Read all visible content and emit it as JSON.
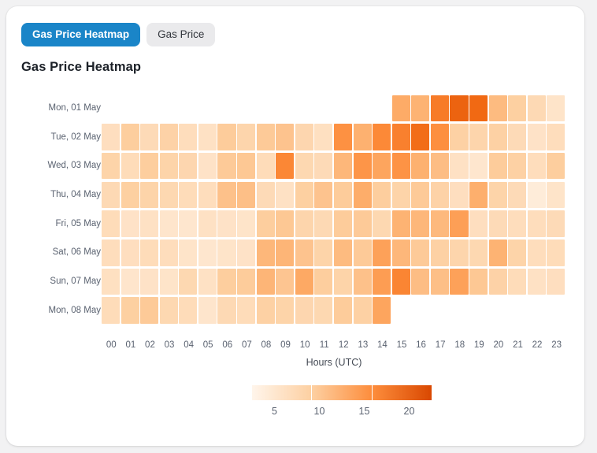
{
  "tabs": [
    {
      "label": "Gas Price Heatmap",
      "active": true
    },
    {
      "label": "Gas Price",
      "active": false
    }
  ],
  "chart_title": "Gas Price Heatmap",
  "colors": {
    "accent": "#1a85c8",
    "tab_inactive_bg": "#eaeaec",
    "card_bg": "#ffffff",
    "page_bg": "#f2f2f3",
    "heat_low": "#fff5eb",
    "heat_high": "#f2711c",
    "axis_text": "#5a6270"
  },
  "chart_data": {
    "type": "heatmap",
    "title": "Gas Price Heatmap",
    "xlabel": "Hours (UTC)",
    "ylabel": "",
    "grid": false,
    "legend_position": "bottom",
    "colorbar": {
      "ticks": [
        "5",
        "10",
        "15",
        "20"
      ],
      "tick_values": [
        5,
        10,
        15,
        20
      ],
      "vmin": 2.5,
      "vmax": 22.5,
      "colormap": "Oranges",
      "segments": 3
    },
    "x": [
      "00",
      "01",
      "02",
      "03",
      "04",
      "05",
      "06",
      "07",
      "08",
      "09",
      "10",
      "11",
      "12",
      "13",
      "14",
      "15",
      "16",
      "17",
      "18",
      "19",
      "20",
      "21",
      "22",
      "23"
    ],
    "y": [
      "Mon, 01 May",
      "Tue, 02 May",
      "Wed, 03 May",
      "Thu, 04 May",
      "Fri, 05 May",
      "Sat, 06 May",
      "Sun, 07 May",
      "Mon, 08 May"
    ],
    "values": [
      [
        null,
        null,
        null,
        null,
        null,
        null,
        null,
        null,
        null,
        null,
        null,
        null,
        null,
        null,
        null,
        12.8,
        12.0,
        17.5,
        19.8,
        19.2,
        11.2,
        9.2,
        7.8,
        6.2
      ],
      [
        7.0,
        9.4,
        7.6,
        8.8,
        7.2,
        6.6,
        9.6,
        8.4,
        9.8,
        10.4,
        8.2,
        6.8,
        15.4,
        12.2,
        16.2,
        17.0,
        18.8,
        15.6,
        9.0,
        8.4,
        9.0,
        7.6,
        6.4,
        7.2
      ],
      [
        8.6,
        7.4,
        9.4,
        8.6,
        8.2,
        6.4,
        9.8,
        10.0,
        7.4,
        16.4,
        8.0,
        7.6,
        11.6,
        15.0,
        13.4,
        15.2,
        12.2,
        11.0,
        6.6,
        5.8,
        9.6,
        9.0,
        7.2,
        9.4
      ],
      [
        7.8,
        9.2,
        8.6,
        8.0,
        7.4,
        7.2,
        10.6,
        10.8,
        7.6,
        6.6,
        9.2,
        10.4,
        9.6,
        12.6,
        9.4,
        8.6,
        9.8,
        8.8,
        7.0,
        12.4,
        8.6,
        7.6,
        4.6,
        6.2
      ],
      [
        7.4,
        6.4,
        6.6,
        6.0,
        5.8,
        6.6,
        6.4,
        6.2,
        9.4,
        10.0,
        8.4,
        7.8,
        9.6,
        9.8,
        8.0,
        12.0,
        11.6,
        11.4,
        14.0,
        7.0,
        7.6,
        7.2,
        7.2,
        7.6
      ],
      [
        7.2,
        7.0,
        7.4,
        7.2,
        6.2,
        5.8,
        6.2,
        6.4,
        11.6,
        11.8,
        10.4,
        8.6,
        11.2,
        9.8,
        13.8,
        11.6,
        9.8,
        9.0,
        8.4,
        8.0,
        12.0,
        8.6,
        7.2,
        7.4
      ],
      [
        6.8,
        6.0,
        6.4,
        6.2,
        8.0,
        6.6,
        9.4,
        9.6,
        11.8,
        10.2,
        13.0,
        9.4,
        8.6,
        10.6,
        14.2,
        16.6,
        11.0,
        10.8,
        13.8,
        10.0,
        8.8,
        7.4,
        6.6,
        7.0
      ],
      [
        7.4,
        9.2,
        9.8,
        8.0,
        7.4,
        6.0,
        7.8,
        7.4,
        9.0,
        8.6,
        8.2,
        8.0,
        9.6,
        9.0,
        13.4,
        null,
        null,
        null,
        null,
        null,
        null,
        null,
        null,
        null
      ]
    ]
  }
}
